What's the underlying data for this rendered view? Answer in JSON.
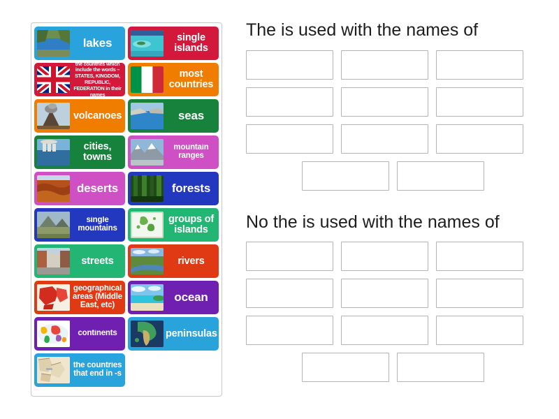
{
  "tiles": [
    {
      "label": "lakes",
      "color": "#29A3DC",
      "size": "lg",
      "image": "lake-photo"
    },
    {
      "label": "single islands",
      "color": "#D2193C",
      "size": "md",
      "image": "island-photo"
    },
    {
      "label": "the countries which include the words – STATES, KINGDOM, REPUBLIC, FEDERATION in their names",
      "color": "#D2193C",
      "size": "xs",
      "image": "uk-flag"
    },
    {
      "label": "most countries",
      "color": "#F07D00",
      "size": "md",
      "image": "italy-flag"
    },
    {
      "label": "volcanoes",
      "color": "#F07D00",
      "size": "md",
      "image": "volcano-photo"
    },
    {
      "label": "seas",
      "color": "#16823C",
      "size": "lg",
      "image": "sea-photo"
    },
    {
      "label": "cities, towns",
      "color": "#16823C",
      "size": "md",
      "image": "city-photo"
    },
    {
      "label": "mountain ranges",
      "color": "#CE50C4",
      "size": "sm",
      "image": "mountains-photo"
    },
    {
      "label": "deserts",
      "color": "#CE50C4",
      "size": "lg",
      "image": "desert-photo"
    },
    {
      "label": "forests",
      "color": "#2238BE",
      "size": "lg",
      "image": "forest-photo"
    },
    {
      "label": "single mountains",
      "color": "#2238BE",
      "size": "sm",
      "image": "single-mountain-photo"
    },
    {
      "label": "groups of islands",
      "color": "#22B573",
      "size": "md",
      "image": "island-map"
    },
    {
      "label": "streets",
      "color": "#22B573",
      "size": "md",
      "image": "street-photo"
    },
    {
      "label": "rivers",
      "color": "#E03A14",
      "size": "md",
      "image": "river-photo"
    },
    {
      "label": "geographical areas (Middle East, etc)",
      "color": "#E03A14",
      "size": "sm",
      "image": "middle-east-map"
    },
    {
      "label": "ocean",
      "color": "#7020B0",
      "size": "lg",
      "image": "ocean-photo"
    },
    {
      "label": "continents",
      "color": "#7020B0",
      "size": "sm",
      "image": "continents-map"
    },
    {
      "label": "peninsulas",
      "color": "#29A3DC",
      "size": "md",
      "image": "peninsula-map"
    },
    {
      "label": "the countries that end in -s",
      "color": "#29A3DC",
      "size": "sm",
      "image": "countries-map"
    }
  ],
  "groups": [
    {
      "heading": "The is used with the names of",
      "rows": [
        3,
        3,
        3,
        2
      ]
    },
    {
      "heading": "No the is used with the names of",
      "rows": [
        3,
        3,
        3,
        2
      ]
    }
  ]
}
